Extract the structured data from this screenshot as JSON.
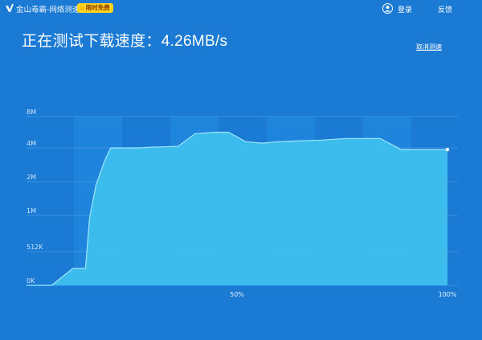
{
  "window": {
    "title": "金山毒霸-网络测速",
    "badge": "限时免费",
    "login_label": "登录",
    "feedback_label": "反馈"
  },
  "speed": {
    "title": "正在测试下载速度：4.26MB/s",
    "cancel_label": "取消测速"
  },
  "colors": {
    "background": "#1a7ad4",
    "area_fill": "#3ec1ee",
    "line": "#9fe6ff",
    "badge": "#ffd21f"
  },
  "icons": [
    "app-logo-icon",
    "flame-icon",
    "user-icon"
  ],
  "chart_data": {
    "type": "area",
    "y_ticks": [
      "0K",
      "512K",
      "1M",
      "2M",
      "4M",
      "8M"
    ],
    "x_tick_labels": [
      {
        "label": "50%",
        "x": 50
      },
      {
        "label": "100%",
        "x": 100
      }
    ],
    "xlim": [
      0,
      100
    ],
    "series": [
      {
        "points": [
          [
            0,
            0
          ],
          [
            6,
            0
          ],
          [
            11,
            0.5
          ],
          [
            14,
            0.5
          ],
          [
            15,
            1.95
          ],
          [
            16.5,
            2.9
          ],
          [
            18.5,
            3.6
          ],
          [
            20,
            4.0
          ],
          [
            27,
            4.0
          ],
          [
            29,
            4.02
          ],
          [
            36,
            4.05
          ],
          [
            40,
            4.45
          ],
          [
            45,
            4.5
          ],
          [
            48,
            4.5
          ],
          [
            52,
            4.2
          ],
          [
            56,
            4.15
          ],
          [
            60,
            4.2
          ],
          [
            64,
            4.22
          ],
          [
            70,
            4.25
          ],
          [
            76,
            4.3
          ],
          [
            84,
            4.3
          ],
          [
            89,
            3.95
          ],
          [
            100,
            3.95
          ]
        ]
      }
    ]
  }
}
